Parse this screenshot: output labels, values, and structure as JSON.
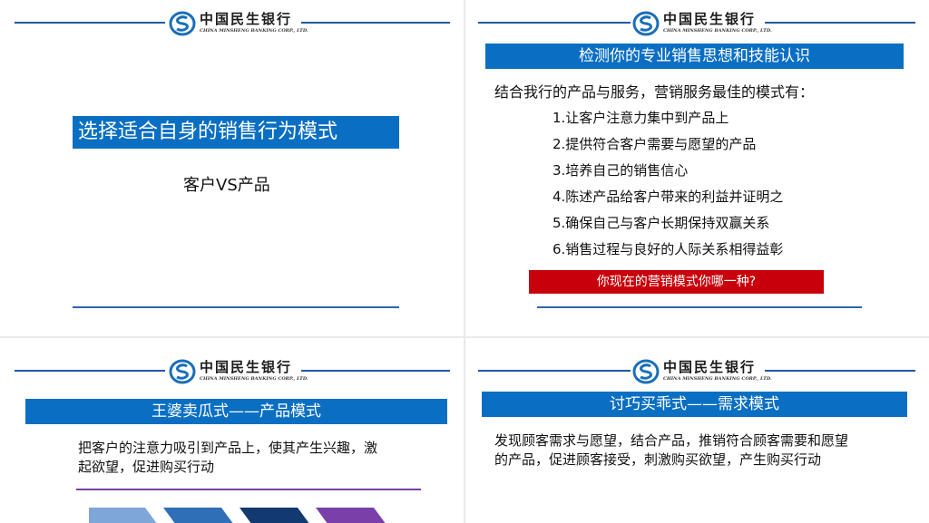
{
  "bank": {
    "name_cn": "中国民生银行",
    "name_en": "CHINA MINSHENG BANKING CORP., LTD."
  },
  "slide1": {
    "title": "选择适合自身的销售行为模式",
    "subtitle": "客户VS产品"
  },
  "slide2": {
    "title": "检测你的专业销售思想和技能认识",
    "intro": "结合我行的产品与服务，营销服务最佳的模式有：",
    "items": [
      "1.让客户注意力集中到产品上",
      "2.提供符合客户需要与愿望的产品",
      "3.培养自己的销售信心",
      "4.陈述产品给客户带来的利益并证明之",
      "5.确保自己与客户长期保持双赢关系",
      "6.销售过程与良好的人际关系相得益彰"
    ],
    "question": "你现在的营销模式你哪一种?"
  },
  "slide3": {
    "title": "王婆卖瓜式——产品模式",
    "body_line1": "把客户的注意力吸引到产品上，使其产生兴趣，激",
    "body_line2": "起欲望，促进购买行动"
  },
  "slide4": {
    "title": "讨巧买乖式——需求模式",
    "body_line1": "发现顾客需求与愿望，结合产品，推销符合顾客需要和愿望",
    "body_line2": "的产品，促进顾客接受，刺激购买欲望，产生购买行动"
  },
  "colors": {
    "brand_blue": "#0a6fc2",
    "line_blue": "#1f5aa6",
    "alert_red": "#c8000b",
    "purple": "#7a3fa8"
  },
  "icons": {
    "logo": "minsheng-logo-icon"
  }
}
